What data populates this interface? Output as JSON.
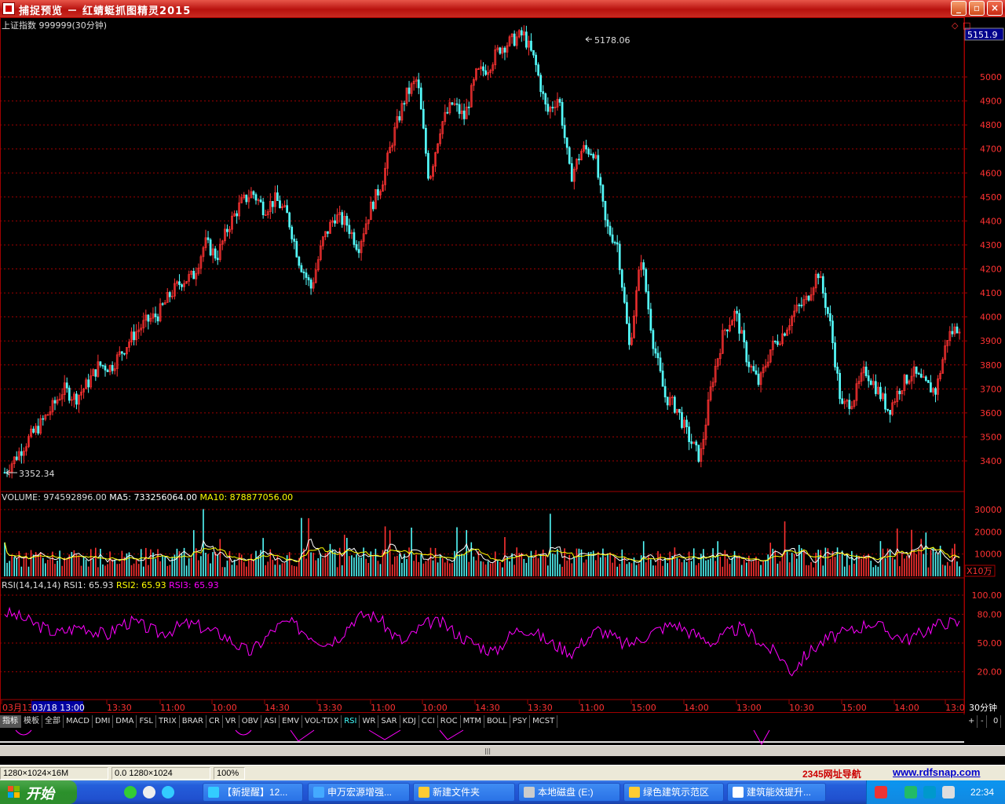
{
  "window": {
    "title": "捕捉预览 － 红蜻蜓抓图精灵2015"
  },
  "chart_header": {
    "symbol": "上证指数 999999(30分钟)",
    "current_price": "5151.9",
    "high_label": "5178.06",
    "low_label": "3352.34"
  },
  "volume_header": {
    "volume_text": "VOLUME: 974592896.00",
    "ma5_text": "MA5: 733256064.00",
    "ma10_text": "MA10: 878877056.00",
    "unit": "X10万"
  },
  "rsi_header": {
    "name": "RSI(14,14,14)",
    "rsi1": "RSI1: 65.93",
    "rsi2": "RSI2: 65.93",
    "rsi3": "RSI3: 65.93"
  },
  "time_axis": {
    "labels": [
      "03月13",
      "03/18 13:00",
      "13:30",
      "11:00",
      "10:00",
      "14:30",
      "13:30",
      "11:00",
      "10:00",
      "14:30",
      "13:30",
      "11:00",
      "15:00",
      "14:00",
      "13:00",
      "10:30",
      "15:00",
      "14:00",
      "13:0"
    ],
    "period": "30分钟"
  },
  "indicator_tabs": [
    "指标",
    "模板",
    "全部",
    "MACD",
    "DMI",
    "DMA",
    "FSL",
    "TRIX",
    "BRAR",
    "CR",
    "VR",
    "OBV",
    "ASI",
    "EMV",
    "VOL-TDX",
    "RSI",
    "WR",
    "SAR",
    "KDJ",
    "CCI",
    "ROC",
    "MTM",
    "BOLL",
    "PSY",
    "MCST"
  ],
  "active_tab": "RSI",
  "statusbar": {
    "size": "1280×1024×16M",
    "coords": "0.0 1280×1024",
    "zoom": "100%",
    "link1": "2345网址导航",
    "link2": "www.rdfsnap.com"
  },
  "taskbar": {
    "start": "开始",
    "tasks": [
      "【新提醒】12...",
      "申万宏源增强...",
      "新建文件夹",
      "本地磁盘 (E:)",
      "绿色建筑示范区",
      "建筑能效提升..."
    ],
    "clock": "22:34"
  },
  "colors": {
    "up": "#ff3232",
    "down": "#54fcfc",
    "grid": "#a00000",
    "rsi": "#ff00ff",
    "ma5": "#ffffff",
    "ma10": "#ffff00"
  },
  "chart_data": [
    {
      "type": "line",
      "title": "上证指数 999999(30分钟)",
      "series": [
        {
          "values": [
            3352,
            3420,
            3490,
            3550,
            3620,
            3700,
            3660,
            3720,
            3800,
            3790,
            3860,
            3930,
            3980,
            4010,
            4090,
            4150,
            4170,
            4310,
            4250,
            4380,
            4470,
            4520,
            4450,
            4490,
            4420,
            4230,
            4120,
            4320,
            4420,
            4390,
            4290,
            4450,
            4560,
            4760,
            4920,
            4990,
            4570,
            4800,
            4890,
            4830,
            5010,
            5040,
            5120,
            5150,
            5178,
            5060,
            4850,
            4920,
            4580,
            4700,
            4690,
            4380,
            4300,
            3870,
            4250,
            3900,
            3670,
            3620,
            3500,
            3410,
            3730,
            3940,
            4020,
            3820,
            3720,
            3870,
            3930,
            4020,
            4070,
            4190,
            3980,
            3620,
            3660,
            3780,
            3700,
            3610,
            3710,
            3770,
            3720,
            3690,
            3920,
            3965
          ]
        }
      ],
      "ylim": [
        3352,
        5178
      ],
      "yticks": [
        3400,
        3500,
        3600,
        3700,
        3800,
        3900,
        4000,
        4100,
        4200,
        4300,
        4400,
        4500,
        4600,
        4700,
        4800,
        4900,
        5000
      ]
    },
    {
      "type": "bar",
      "title": "VOLUME",
      "yticks": [
        10000,
        20000,
        30000
      ],
      "unit": "X10万"
    },
    {
      "type": "line",
      "title": "RSI(14,14,14)",
      "yticks": [
        20.0,
        50.0,
        80.0,
        100.0
      ],
      "series": [
        {
          "name": "RSI1",
          "values": [
            82,
            78,
            72,
            66,
            60,
            64,
            68,
            62,
            58,
            70,
            72,
            66,
            60,
            64,
            70,
            68,
            62,
            58,
            48,
            40,
            52,
            66,
            72,
            64,
            56,
            50,
            58,
            74,
            80,
            76,
            60,
            50,
            64,
            72,
            70,
            60,
            52,
            46,
            40,
            56,
            66,
            62,
            52,
            46,
            40,
            54,
            64,
            58,
            48,
            52,
            60,
            66,
            70,
            62,
            56,
            50,
            60,
            66,
            58,
            46,
            38,
            20,
            36,
            48,
            56,
            60,
            64,
            72,
            66,
            58,
            54,
            60,
            68,
            72,
            70
          ]
        }
      ]
    }
  ]
}
